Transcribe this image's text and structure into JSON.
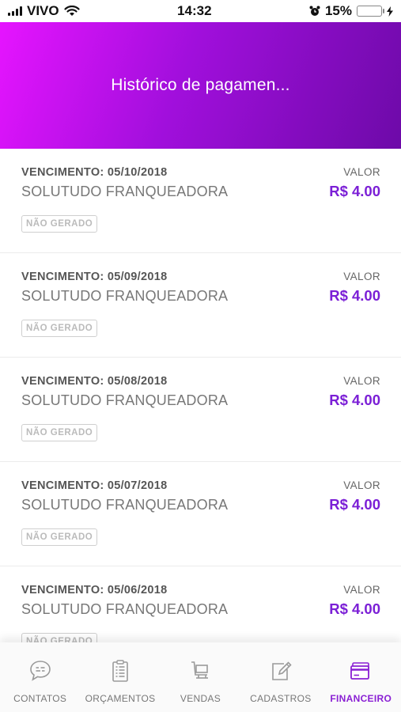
{
  "status_bar": {
    "carrier": "VIVO",
    "time": "14:32",
    "battery_percent": "15%",
    "battery_level": 0.15
  },
  "header": {
    "title": "Histórico de pagamen..."
  },
  "payments": [
    {
      "due": "VENCIMENTO: 05/10/2018",
      "company": "SOLUTUDO FRANQUEADORA",
      "value_label": "VALOR",
      "value": "R$ 4.00",
      "status": "NÃO GERADO"
    },
    {
      "due": "VENCIMENTO: 05/09/2018",
      "company": "SOLUTUDO FRANQUEADORA",
      "value_label": "VALOR",
      "value": "R$ 4.00",
      "status": "NÃO GERADO"
    },
    {
      "due": "VENCIMENTO: 05/08/2018",
      "company": "SOLUTUDO FRANQUEADORA",
      "value_label": "VALOR",
      "value": "R$ 4.00",
      "status": "NÃO GERADO"
    },
    {
      "due": "VENCIMENTO: 05/07/2018",
      "company": "SOLUTUDO FRANQUEADORA",
      "value_label": "VALOR",
      "value": "R$ 4.00",
      "status": "NÃO GERADO"
    },
    {
      "due": "VENCIMENTO: 05/06/2018",
      "company": "SOLUTUDO FRANQUEADORA",
      "value_label": "VALOR",
      "value": "R$ 4.00",
      "status": "NÃO GERADO"
    }
  ],
  "tabs": [
    {
      "label": "CONTATOS",
      "icon": "chat-bubble-icon"
    },
    {
      "label": "ORÇAMENTOS",
      "icon": "clipboard-list-icon"
    },
    {
      "label": "VENDAS",
      "icon": "cart-icon"
    },
    {
      "label": "CADASTROS",
      "icon": "edit-icon"
    },
    {
      "label": "FINANCEIRO",
      "icon": "credit-card-icon",
      "active": true
    }
  ],
  "colors": {
    "accent": "#7b1fd6",
    "header_gradient_start": "#e614ff",
    "header_gradient_end": "#6d0aa8",
    "active_tab": "#8a20d4"
  }
}
